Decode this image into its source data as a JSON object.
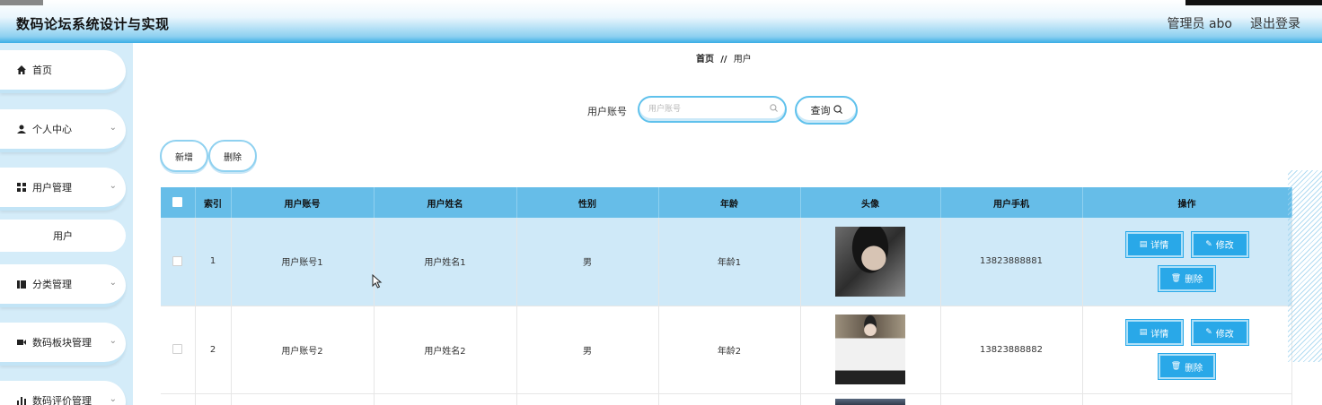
{
  "header": {
    "title": "数码论坛系统设计与实现",
    "user": "管理员 abo",
    "logout": "退出登录"
  },
  "sidebar": {
    "items": [
      {
        "label": "首页",
        "icon": "home-icon",
        "glyph": "⌂"
      },
      {
        "label": "个人中心",
        "icon": "user-icon",
        "glyph": "👤"
      },
      {
        "label": "用户管理",
        "icon": "grid-icon",
        "glyph": "▦"
      },
      {
        "label": "分类管理",
        "icon": "book-icon",
        "glyph": "▮"
      },
      {
        "label": "数码板块管理",
        "icon": "video-icon",
        "glyph": "▶"
      },
      {
        "label": "数码评价管理",
        "icon": "bar-chart-icon",
        "glyph": "▮"
      }
    ],
    "sub_item": "用户",
    "chevron": "⌄"
  },
  "breadcrumb": {
    "home": "首页",
    "sep": "//",
    "current": "用户"
  },
  "search": {
    "label": "用户账号",
    "placeholder": "用户账号",
    "button": "查询",
    "button_icon": "○"
  },
  "actions": {
    "add": "新增",
    "delete": "删除"
  },
  "table": {
    "headers": [
      "索引",
      "用户账号",
      "用户姓名",
      "性别",
      "年龄",
      "头像",
      "用户手机",
      "操作"
    ],
    "rows": [
      {
        "index": "1",
        "account": "用户账号1",
        "name": "用户姓名1",
        "gender": "男",
        "age": "年龄1",
        "phone": "13823888881"
      },
      {
        "index": "2",
        "account": "用户账号2",
        "name": "用户姓名2",
        "gender": "男",
        "age": "年龄2",
        "phone": "13823888882"
      }
    ],
    "ops": {
      "detail": "详情",
      "edit": "修改",
      "delete": "删除"
    }
  },
  "colors": {
    "accent": "#29a8e8",
    "header_row": "#66bde8",
    "selected_row": "#cfe9f8",
    "sidebar_bg": "#d4ecf9"
  }
}
